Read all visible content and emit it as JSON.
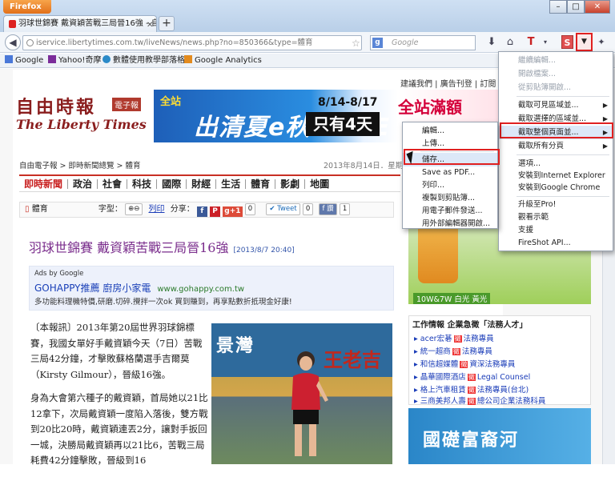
{
  "browser": {
    "app_button": "Firefox",
    "tab_title": "羽球世錦賽 戴資穎苦戰三局晉16強 - 自...",
    "url": "iservice.libertytimes.com.tw/liveNews/news.php?no=850366&type=體育",
    "search_placeholder": "Google",
    "window_controls": [
      "–",
      "□",
      "✕"
    ]
  },
  "bookmarks": [
    {
      "label": "Google",
      "icon": "google-icon"
    },
    {
      "label": "Yahoo!奇摩",
      "icon": "yahoo-icon"
    },
    {
      "label": "數體使用教學部落格",
      "icon": "blog-icon"
    },
    {
      "label": "Google Analytics",
      "icon": "analytics-icon"
    }
  ],
  "site": {
    "top_links": "建議我們 | 廣告刊登 | 訂閱",
    "logo_main": "自由時報",
    "logo_tag": "電子報",
    "logo_sub": "The Liberty Times",
    "banner": {
      "line1": "全站",
      "line2": "出清夏e秋 SALE",
      "dates": "8/14-8/17",
      "days": "只有4天",
      "right": "全站滿額"
    },
    "breadcrumb": "自由電子報 > 即時新聞總覽 > 體育",
    "date": "2013年8月14日．星期三",
    "menu": [
      "即時新聞",
      "政治",
      "社會",
      "科技",
      "國際",
      "財經",
      "生活",
      "體育",
      "影劇",
      "地圖"
    ],
    "tools": {
      "section": "體育",
      "font_label": "字型：",
      "print": "列印",
      "share": "分享：",
      "g_count": "0",
      "tweet": "Tweet",
      "tweet_count": "0",
      "fb": "讚",
      "fb_count": "1"
    },
    "headline": "羽球世錦賽 戴資穎苦戰三局晉16強",
    "headline_date": "[2013/8/7 20:40]",
    "ad": {
      "by": "Ads by Google",
      "title": "GOHAPPY推薦 廚房小家電",
      "url": "www.gohappy.com.tw",
      "desc": "多功能料理機特價,研磨.切碎.攪拌一次ok 買到賺到，再享點數折抵現金好康!"
    },
    "article": [
      "〔本報訊〕2013年第20屆世界羽球錦標賽，我國女單好手戴資穎今天（7日）苦戰三局42分鐘，才擊敗蘇格蘭選手吉爾莫（Kirsty Gilmour），晉級16強。",
      "身為大會第六種子的戴資穎，首局她以21比12拿下，次局戴資穎一度陷入落後，雙方戰到20比20時，戴資穎連丟2分，讓對手扳回一城，決勝局戴資穎再以21比6，苦戰三局耗費42分鐘擊敗，晉級到16"
    ],
    "photo_text": [
      "景灣",
      "王老吉"
    ],
    "sidebar_ad_text": "10W&7W 白光 黃光",
    "jobs_title": "工作情報 企業急徵「法務人才」",
    "jobs": [
      {
        "company": "acer宏碁",
        "role": "法務專員"
      },
      {
        "company": "統一超商",
        "role": "法務專員"
      },
      {
        "company": "和信超媒體",
        "role": "資深法務專員"
      },
      {
        "company": "晶華國際酒店",
        "role": "Legal Counsel"
      },
      {
        "company": "格上汽車租賃",
        "role": "法務專員(台北)"
      },
      {
        "company": "三商美邦人壽",
        "role": "總公司企業法務科員"
      }
    ],
    "jobs_badge": "徵",
    "sidebar_ad2": "國礎富裔河"
  },
  "fireshot_menu": {
    "items": [
      {
        "label": "繼續編輯...",
        "disabled": true
      },
      {
        "label": "開啟檔案...",
        "disabled": true
      },
      {
        "label": "從剪貼簿開啟...",
        "disabled": true
      },
      {
        "label": "截取可見區域並...",
        "disabled": false,
        "submenu": true
      },
      {
        "label": "截取選擇的區域並...",
        "disabled": false,
        "submenu": true
      },
      {
        "label": "截取整個頁面並...",
        "disabled": false,
        "submenu": true,
        "highlighted": true
      },
      {
        "label": "截取所有分頁",
        "disabled": false,
        "submenu": true
      },
      {
        "label": "選項...",
        "disabled": false
      },
      {
        "label": "安裝到Internet Explorer",
        "disabled": false
      },
      {
        "label": "安裝到Google Chrome",
        "disabled": false
      },
      {
        "label": "升級至Pro!",
        "disabled": false
      },
      {
        "label": "觀看示範",
        "disabled": false
      },
      {
        "label": "支援",
        "disabled": false
      },
      {
        "label": "FireShot API...",
        "disabled": false
      }
    ]
  },
  "capture_submenu": {
    "items": [
      {
        "label": "編輯..."
      },
      {
        "label": "上傳..."
      },
      {
        "label": "儲存...",
        "highlighted": true
      },
      {
        "label": "Save as PDF..."
      },
      {
        "label": "列印..."
      },
      {
        "label": "複製到剪貼簿..."
      },
      {
        "label": "用電子郵件發送..."
      },
      {
        "label": "用外部編輯器開啟..."
      }
    ]
  },
  "colors": {
    "highlight_box": "#e02020",
    "menu_accent": "#c83024",
    "headline": "#7a2d8c",
    "link": "#1a3cb8"
  }
}
